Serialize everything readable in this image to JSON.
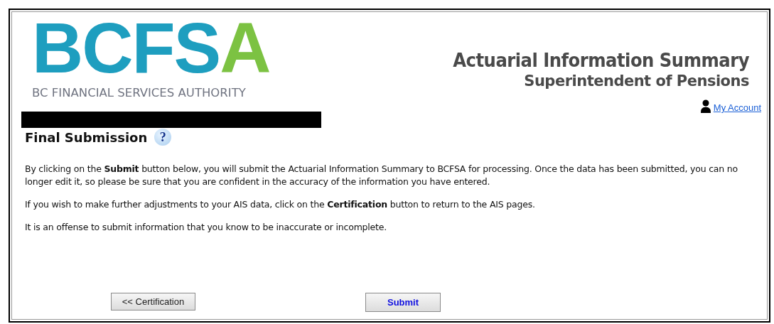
{
  "header": {
    "logo": {
      "wordmark": "BCFSA",
      "tagline": "BC FINANCIAL SERVICES AUTHORITY"
    },
    "title": "Actuarial Information Summary",
    "subtitle": "Superintendent of Pensions",
    "account_link": "My Account"
  },
  "page": {
    "heading": "Final Submission",
    "help_icon": "?",
    "paragraphs": [
      "By clicking on the **Submit** button below, you will submit the Actuarial Information Summary to BCFSA for processing. Once the data has been submitted, you can no longer edit it, so please be sure that you are confident in the accuracy of the information you have entered.",
      "If you wish to make further adjustments to your AIS data, click on the **Certification** button to return to the AIS pages.",
      "It is an offense to submit information that you know to be inaccurate or incomplete."
    ]
  },
  "buttons": [
    {
      "label": "<< Certification",
      "kind": "back"
    },
    {
      "label": "Submit",
      "kind": "primary"
    }
  ]
}
